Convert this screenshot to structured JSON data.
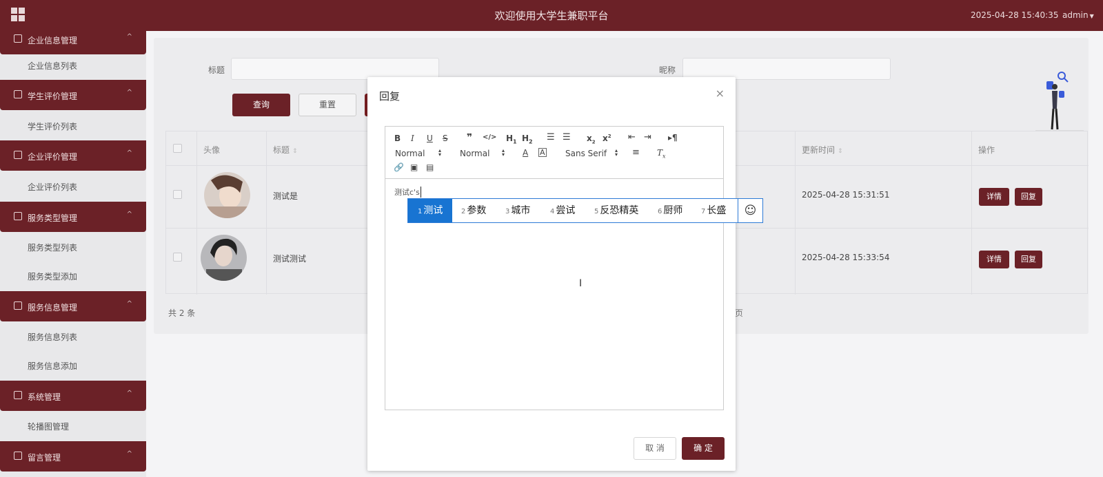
{
  "header": {
    "title": "欢迎使用大学生兼职平台",
    "datetime": "2025-04-28 15:40:35",
    "user": "admin"
  },
  "sidebar": {
    "groups": [
      {
        "label": "企业信息管理",
        "items": [
          "企业信息列表"
        ]
      },
      {
        "label": "学生评价管理",
        "items": [
          "学生评价列表"
        ]
      },
      {
        "label": "企业评价管理",
        "items": [
          "企业评价列表"
        ]
      },
      {
        "label": "服务类型管理",
        "items": [
          "服务类型列表",
          "服务类型添加"
        ]
      },
      {
        "label": "服务信息管理",
        "items": [
          "服务信息列表",
          "服务信息添加"
        ]
      },
      {
        "label": "系统管理",
        "items": [
          "轮播图管理"
        ]
      },
      {
        "label": "留言管理",
        "items": []
      }
    ]
  },
  "search": {
    "title_label": "标题",
    "nickname_label": "昵称",
    "query_button": "查询",
    "reset_button": "重置"
  },
  "table": {
    "headers": {
      "avatar": "头像",
      "title": "标题",
      "updated": "更新时间",
      "ops": "操作"
    },
    "rows": [
      {
        "title": "测试是",
        "updated": "2025-04-28 15:31:51",
        "detail": "详情",
        "reply": "回复"
      },
      {
        "title": "测试测试",
        "updated": "2025-04-28 15:33:54",
        "detail": "详情",
        "reply": "回复"
      }
    ],
    "total": "共 2 条",
    "pager_tail": "页"
  },
  "dialog": {
    "title": "回复",
    "close": "×",
    "toolbar": {
      "header_select": "Normal",
      "size_select": "Normal",
      "font_select": "Sans Serif"
    },
    "editor_text": "测试c's",
    "ime_candidates": [
      {
        "n": "1",
        "text": "测试"
      },
      {
        "n": "2",
        "text": "参数"
      },
      {
        "n": "3",
        "text": "城市"
      },
      {
        "n": "4",
        "text": "尝试"
      },
      {
        "n": "5",
        "text": "反恐精英"
      },
      {
        "n": "6",
        "text": "厨师"
      },
      {
        "n": "7",
        "text": "长盛"
      }
    ],
    "cancel_button": "取 消",
    "ok_button": "确 定"
  },
  "colors": {
    "brand": "#6b2127",
    "ime_highlight": "#1874d2"
  }
}
